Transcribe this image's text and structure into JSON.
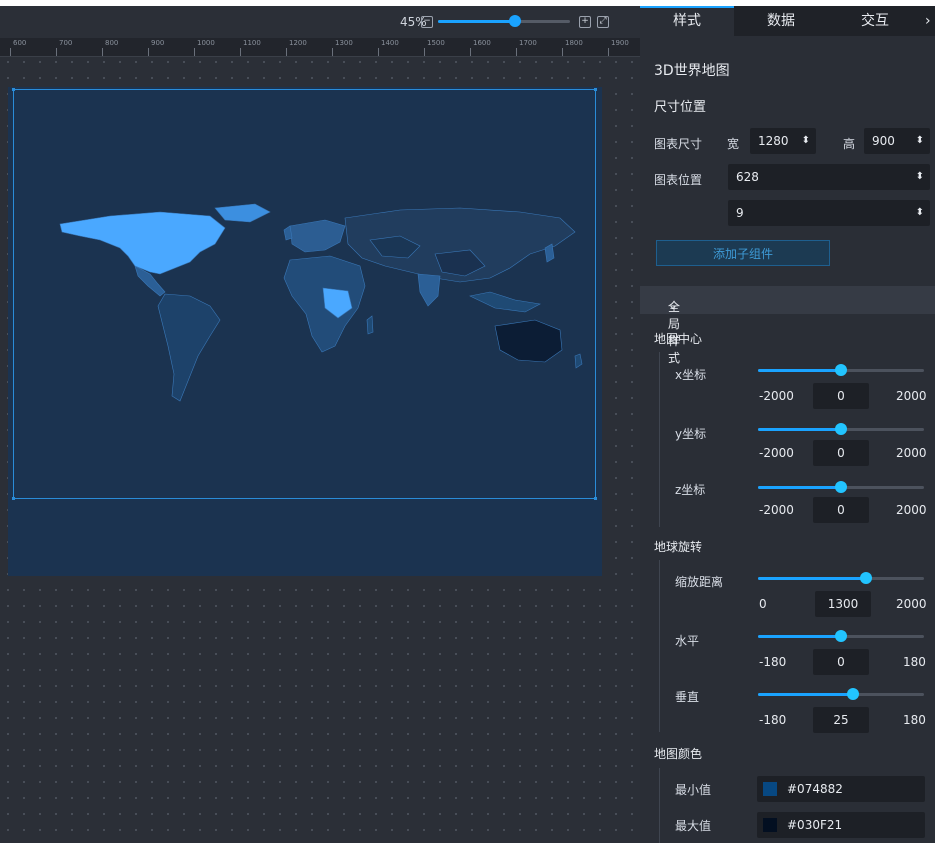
{
  "zoom": {
    "label": "45%",
    "minus_icon": "minus-square-icon",
    "plus_icon": "plus-square-icon",
    "fit_icon": "fit-screen-icon",
    "value_pct": 45
  },
  "ruler": {
    "labels": [
      "600",
      "700",
      "800",
      "900",
      "1000",
      "1100",
      "1200",
      "1300",
      "1400",
      "1500",
      "1600",
      "1700",
      "1800",
      "1900"
    ]
  },
  "tabs": [
    {
      "label": "样式",
      "active": true
    },
    {
      "label": "数据",
      "active": false
    },
    {
      "label": "交互",
      "active": false
    }
  ],
  "component_title": "3D世界地图",
  "size_position": {
    "section": "尺寸位置",
    "size_label": "图表尺寸",
    "width_label": "宽",
    "width": "1280",
    "height_label": "高",
    "height": "900",
    "position_label": "图表位置",
    "pos_x": "628",
    "pos_y": "9",
    "add_child": "添加子组件"
  },
  "global_style": {
    "header": "全局样式",
    "map_center": {
      "label": "地图中心",
      "x": {
        "label": "x坐标",
        "min": "-2000",
        "value": "0",
        "max": "2000",
        "fraction": 0.5
      },
      "y": {
        "label": "y坐标",
        "min": "-2000",
        "value": "0",
        "max": "2000",
        "fraction": 0.5
      },
      "z": {
        "label": "z坐标",
        "min": "-2000",
        "value": "0",
        "max": "2000",
        "fraction": 0.5
      }
    },
    "rotation": {
      "label": "地球旋转",
      "distance": {
        "label": "缩放距离",
        "min": "0",
        "value": "1300",
        "max": "2000",
        "fraction": 0.65
      },
      "horizontal": {
        "label": "水平",
        "min": "-180",
        "value": "0",
        "max": "180",
        "fraction": 0.5
      },
      "vertical": {
        "label": "垂直",
        "min": "-180",
        "value": "25",
        "max": "180",
        "fraction": 0.57
      }
    },
    "map_color": {
      "label": "地图颜色",
      "min": {
        "label": "最小值",
        "value": "#074882",
        "color": "#074882"
      },
      "max": {
        "label": "最大值",
        "value": "#030F21",
        "color": "#030F21"
      }
    }
  },
  "colors": {
    "accent": "#1aa3ff",
    "map_land": "#2a5a8c",
    "map_highlight": "#4aa8ff",
    "artboard": "#1b3350"
  }
}
